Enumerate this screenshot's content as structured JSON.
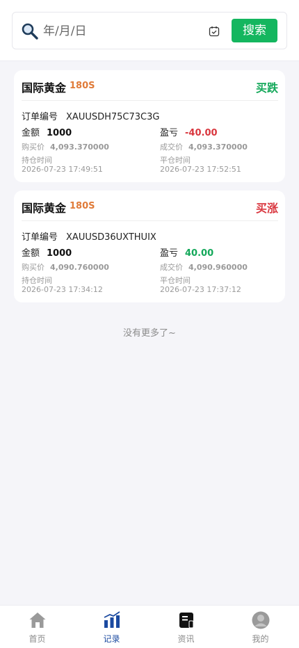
{
  "search": {
    "placeholder": "年/月/日",
    "button_label": "搜索"
  },
  "orders": [
    {
      "symbol": "国际黄金",
      "duration": "180S",
      "direction": "买跌",
      "direction_color": "#14a85a",
      "order_no_label": "订单编号",
      "order_no": "XAUUSDH75C73C3G",
      "amount_label": "金额",
      "amount": "1000",
      "pnl_label": "盈亏",
      "pnl": "-40.00",
      "pnl_color": "#d9363e",
      "buy_price_label": "购买价",
      "buy_price": "4,093.370000",
      "deal_price_label": "成交价",
      "deal_price": "4,093.370000",
      "open_time_label": "持仓时间",
      "open_time": "2026-07-23 17:49:51",
      "close_time_label": "平仓时间",
      "close_time": "2026-07-23 17:52:51"
    },
    {
      "symbol": "国际黄金",
      "duration": "180S",
      "direction": "买涨",
      "direction_color": "#d9363e",
      "order_no_label": "订单编号",
      "order_no": "XAUUSD36UXTHUIX",
      "amount_label": "金额",
      "amount": "1000",
      "pnl_label": "盈亏",
      "pnl": "40.00",
      "pnl_color": "#14a85a",
      "buy_price_label": "购买价",
      "buy_price": "4,090.760000",
      "deal_price_label": "成交价",
      "deal_price": "4,090.960000",
      "open_time_label": "持仓时间",
      "open_time": "2026-07-23 17:34:12",
      "close_time_label": "平仓时间",
      "close_time": "2026-07-23 17:37:12"
    }
  ],
  "list_footer": "没有更多了~",
  "tabbar": {
    "items": [
      {
        "label": "首页",
        "icon": "home-icon",
        "active": false
      },
      {
        "label": "记录",
        "icon": "bar-chart-icon",
        "active": true
      },
      {
        "label": "资讯",
        "icon": "news-icon",
        "active": false
      },
      {
        "label": "我的",
        "icon": "user-icon",
        "active": false
      }
    ],
    "active_color": "#1b4aa0",
    "inactive_color": "#8a8a8a"
  },
  "colors": {
    "brand_green": "#14b65f",
    "accent_orange": "#e07b39",
    "background": "#f5f5f9"
  }
}
